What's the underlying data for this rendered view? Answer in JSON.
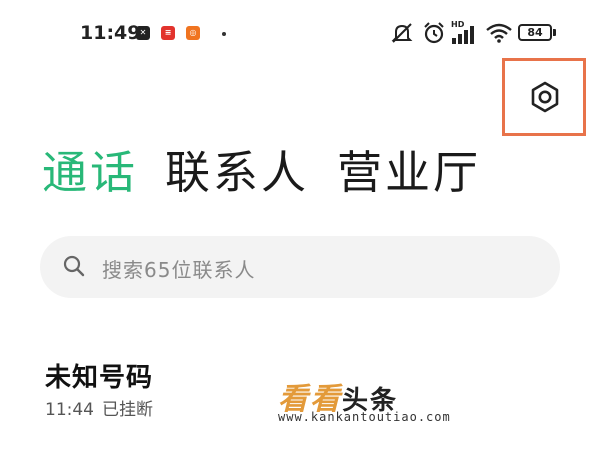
{
  "status_bar": {
    "time": "11:49",
    "battery": "84",
    "icons": [
      "capcut-app-icon",
      "news-app-icon",
      "kuaishou-app-icon",
      "mute-icon",
      "alarm-icon",
      "signal-icon",
      "wifi-icon"
    ],
    "network_label": "HD"
  },
  "header": {
    "settings_icon": "gear-icon"
  },
  "tabs": [
    {
      "label": "通话",
      "active": true
    },
    {
      "label": "联系人",
      "active": false
    },
    {
      "label": "营业厅",
      "active": false
    }
  ],
  "search": {
    "placeholder": "搜索65位联系人",
    "icon": "search-icon"
  },
  "calls": [
    {
      "name": "未知号码",
      "time": "11:44",
      "status": "已挂断"
    }
  ],
  "watermark": {
    "title_colored": "看看",
    "title_dark": "头条",
    "url": "www.kankantoutiao.com"
  },
  "colors": {
    "accent": "#28b878",
    "highlight": "#e8734a",
    "watermark": "#e39a3a",
    "search_bg": "#f3f3f3"
  }
}
